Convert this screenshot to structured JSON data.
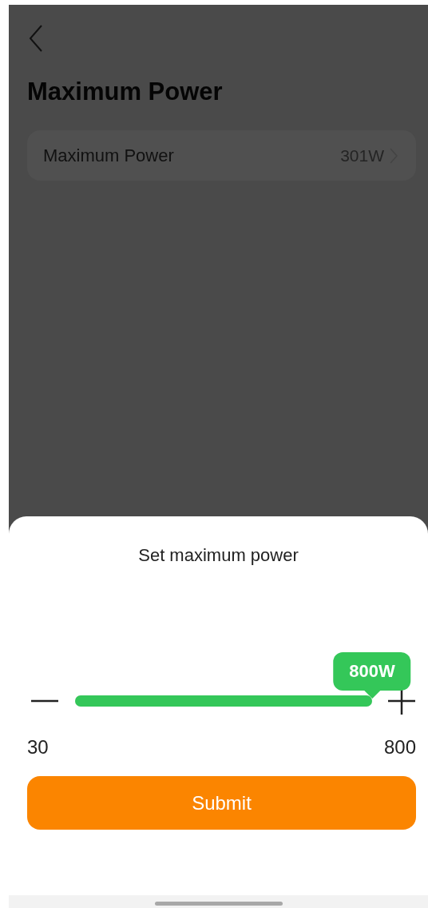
{
  "page": {
    "title": "Maximum Power"
  },
  "settings": [
    {
      "label": "Maximum Power",
      "value": "301W"
    }
  ],
  "sheet": {
    "title": "Set maximum power",
    "slider": {
      "level": 1,
      "tooltip": "800W",
      "min_label": "30",
      "max_label": "800"
    },
    "button": "Submit"
  }
}
